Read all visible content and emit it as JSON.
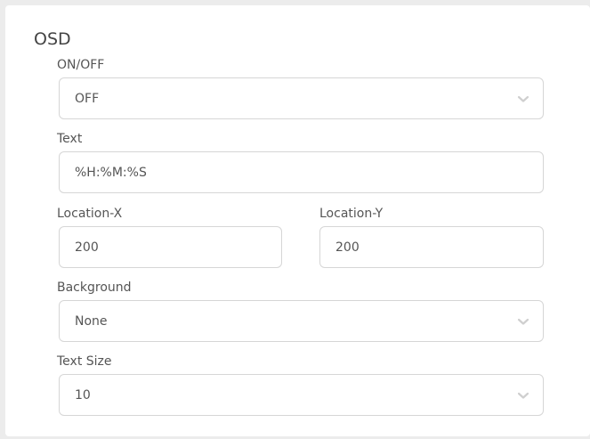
{
  "osd": {
    "title": "OSD",
    "on_off": {
      "label": "ON/OFF",
      "value": "OFF",
      "icon": "chevron-down-icon"
    },
    "text": {
      "label": "Text",
      "value": "%H:%M:%S"
    },
    "location_x": {
      "label": "Location-X",
      "value": "200"
    },
    "location_y": {
      "label": "Location-Y",
      "value": "200"
    },
    "background": {
      "label": "Background",
      "value": "None",
      "icon": "chevron-down-icon"
    },
    "text_size": {
      "label": "Text Size",
      "value": "10",
      "icon": "chevron-down-icon"
    }
  },
  "colors": {
    "page_background": "#ececec",
    "panel_background": "#ffffff",
    "control_border": "#d6d6d6",
    "text": "#555555",
    "chevron": "#cfcfcf"
  }
}
